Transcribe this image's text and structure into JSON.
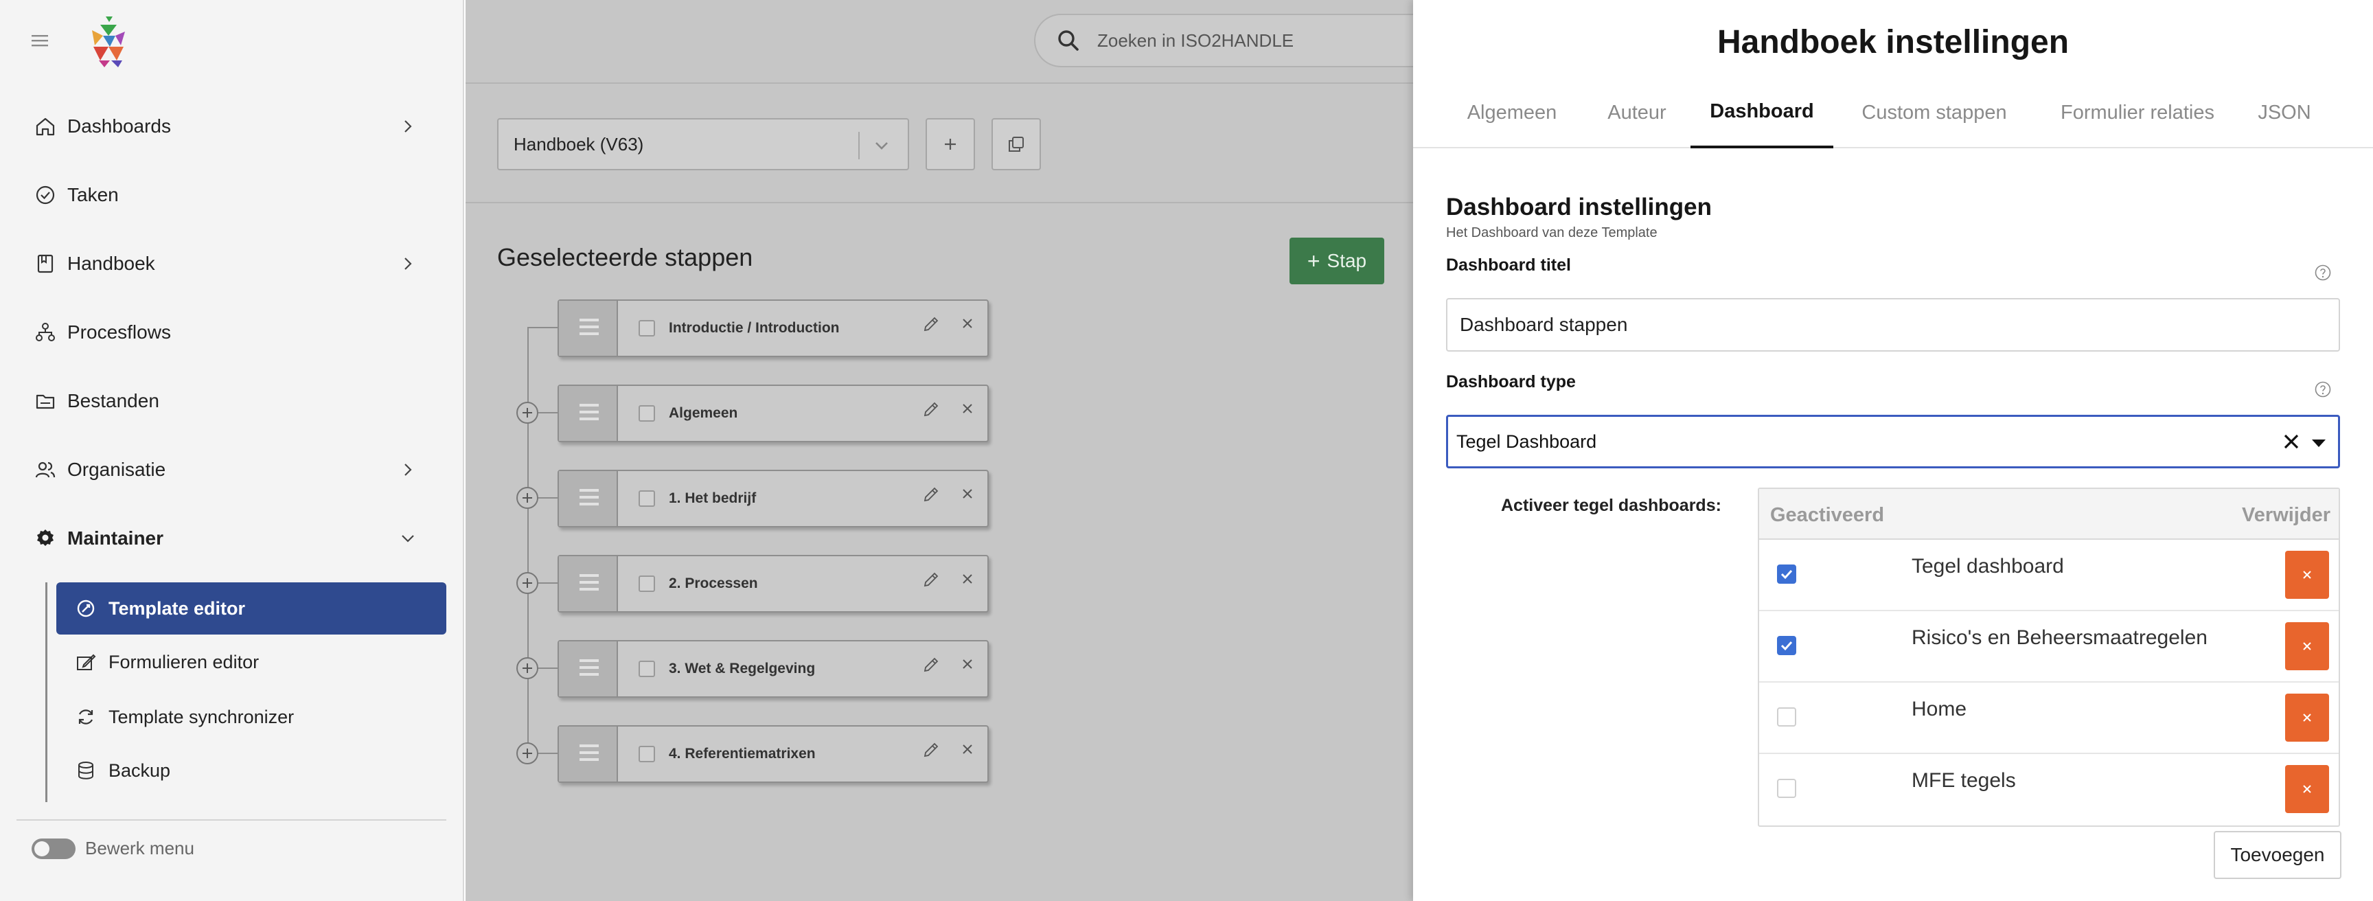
{
  "sidebar": {
    "nav": [
      {
        "label": "Dashboards",
        "icon": "home-icon",
        "has_chevron": true
      },
      {
        "label": "Taken",
        "icon": "check-circle-icon",
        "has_chevron": false
      },
      {
        "label": "Handboek",
        "icon": "book-icon",
        "has_chevron": true
      },
      {
        "label": "Procesflows",
        "icon": "flow-icon",
        "has_chevron": false
      },
      {
        "label": "Bestanden",
        "icon": "folder-icon",
        "has_chevron": false
      },
      {
        "label": "Organisatie",
        "icon": "users-icon",
        "has_chevron": true
      },
      {
        "label": "Maintainer",
        "icon": "gear-icon",
        "has_chevron": true,
        "expanded": true
      }
    ],
    "subnav": [
      {
        "label": "Template editor",
        "icon": "template-icon",
        "active": true
      },
      {
        "label": "Formulieren editor",
        "icon": "form-edit-icon",
        "active": false
      },
      {
        "label": "Template synchronizer",
        "icon": "sync-icon",
        "active": false
      },
      {
        "label": "Backup",
        "icon": "database-icon",
        "active": false
      }
    ],
    "toggle_label": "Bewerk menu",
    "toggle_on": false
  },
  "header": {
    "search_placeholder": "Zoeken in ISO2HANDLE"
  },
  "main": {
    "handbook_select": "Handboek (V63)",
    "selected_title": "Geselecteerde stappen",
    "add_step_label": "Stap",
    "steps": [
      {
        "label": "Introductie / Introduction"
      },
      {
        "label": "Algemeen"
      },
      {
        "label": "1. Het bedrijf"
      },
      {
        "label": "2. Processen"
      },
      {
        "label": "3. Wet & Regelgeving"
      },
      {
        "label": "4. Referentiematrixen"
      }
    ]
  },
  "panel": {
    "title": "Handboek instellingen",
    "tabs": [
      {
        "label": "Algemeen",
        "active": false
      },
      {
        "label": "Auteur",
        "active": false
      },
      {
        "label": "Dashboard",
        "active": true
      },
      {
        "label": "Custom stappen",
        "active": false
      },
      {
        "label": "Formulier relaties",
        "active": false
      },
      {
        "label": "JSON",
        "active": false
      }
    ],
    "section_title": "Dashboard instellingen",
    "section_subtitle": "Het Dashboard van deze Template",
    "dashboard_title_label": "Dashboard titel",
    "dashboard_title_value": "Dashboard stappen",
    "dashboard_type_label": "Dashboard type",
    "dashboard_type_value": "Tegel Dashboard",
    "activate_label": "Activeer tegel dashboards:",
    "table": {
      "col_active": "Geactiveerd",
      "col_remove": "Verwijder",
      "rows": [
        {
          "name": "Tegel dashboard",
          "checked": true
        },
        {
          "name": "Risico's en Beheersmaatregelen",
          "checked": true
        },
        {
          "name": "Home",
          "checked": false
        },
        {
          "name": "MFE tegels",
          "checked": false
        }
      ]
    },
    "add_button": "Toevoegen"
  },
  "colors": {
    "active_nav": "#2f4a8f",
    "stap_button": "#3c7a4a",
    "focus_border": "#3b5bbf",
    "checkbox_on": "#3b6fd4",
    "delete_button": "#e8652d"
  }
}
